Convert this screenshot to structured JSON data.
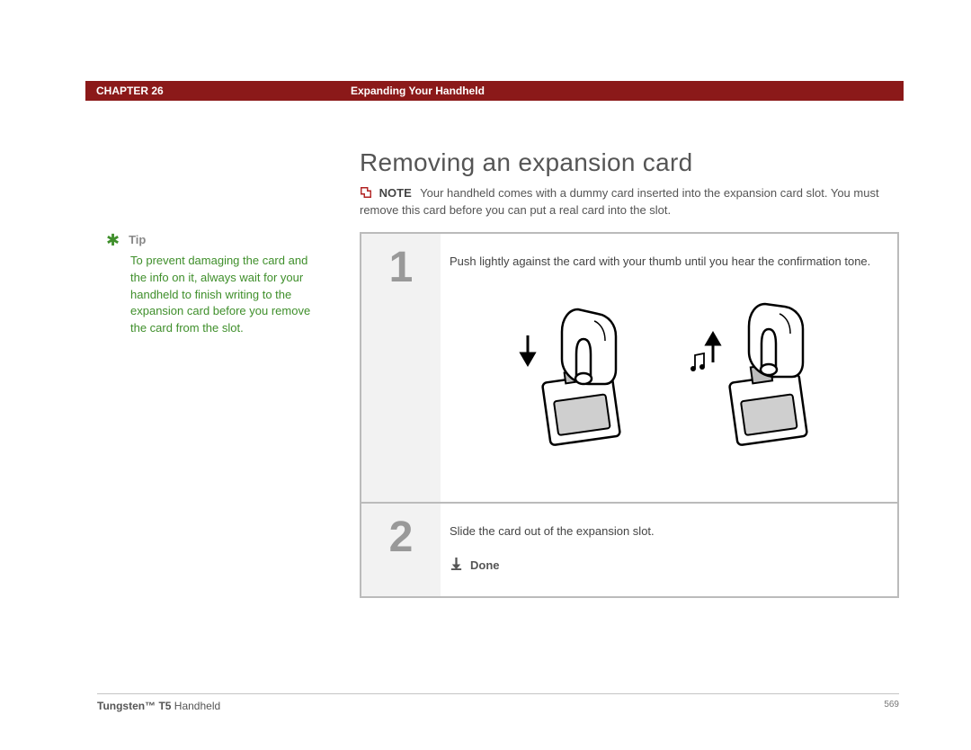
{
  "header": {
    "chapter": "CHAPTER 26",
    "section": "Expanding Your Handheld"
  },
  "title": "Removing an expansion card",
  "note": {
    "label": "NOTE",
    "text": "Your handheld comes with a dummy card inserted into the expansion card slot. You must remove this card before you can put a real card into the slot."
  },
  "tip": {
    "label": "Tip",
    "body": "To prevent damaging the card and the info on it, always wait for your handheld to finish writing to the expansion card before you remove the card from the slot."
  },
  "steps": {
    "s1": {
      "num": "1",
      "text": "Push lightly against the card with your thumb until you hear the confirmation tone."
    },
    "s2": {
      "num": "2",
      "text": "Slide the card out of the expansion slot.",
      "done": "Done"
    }
  },
  "footer": {
    "product_bold": "Tungsten™ T5",
    "product_rest": " Handheld",
    "page": "569"
  }
}
